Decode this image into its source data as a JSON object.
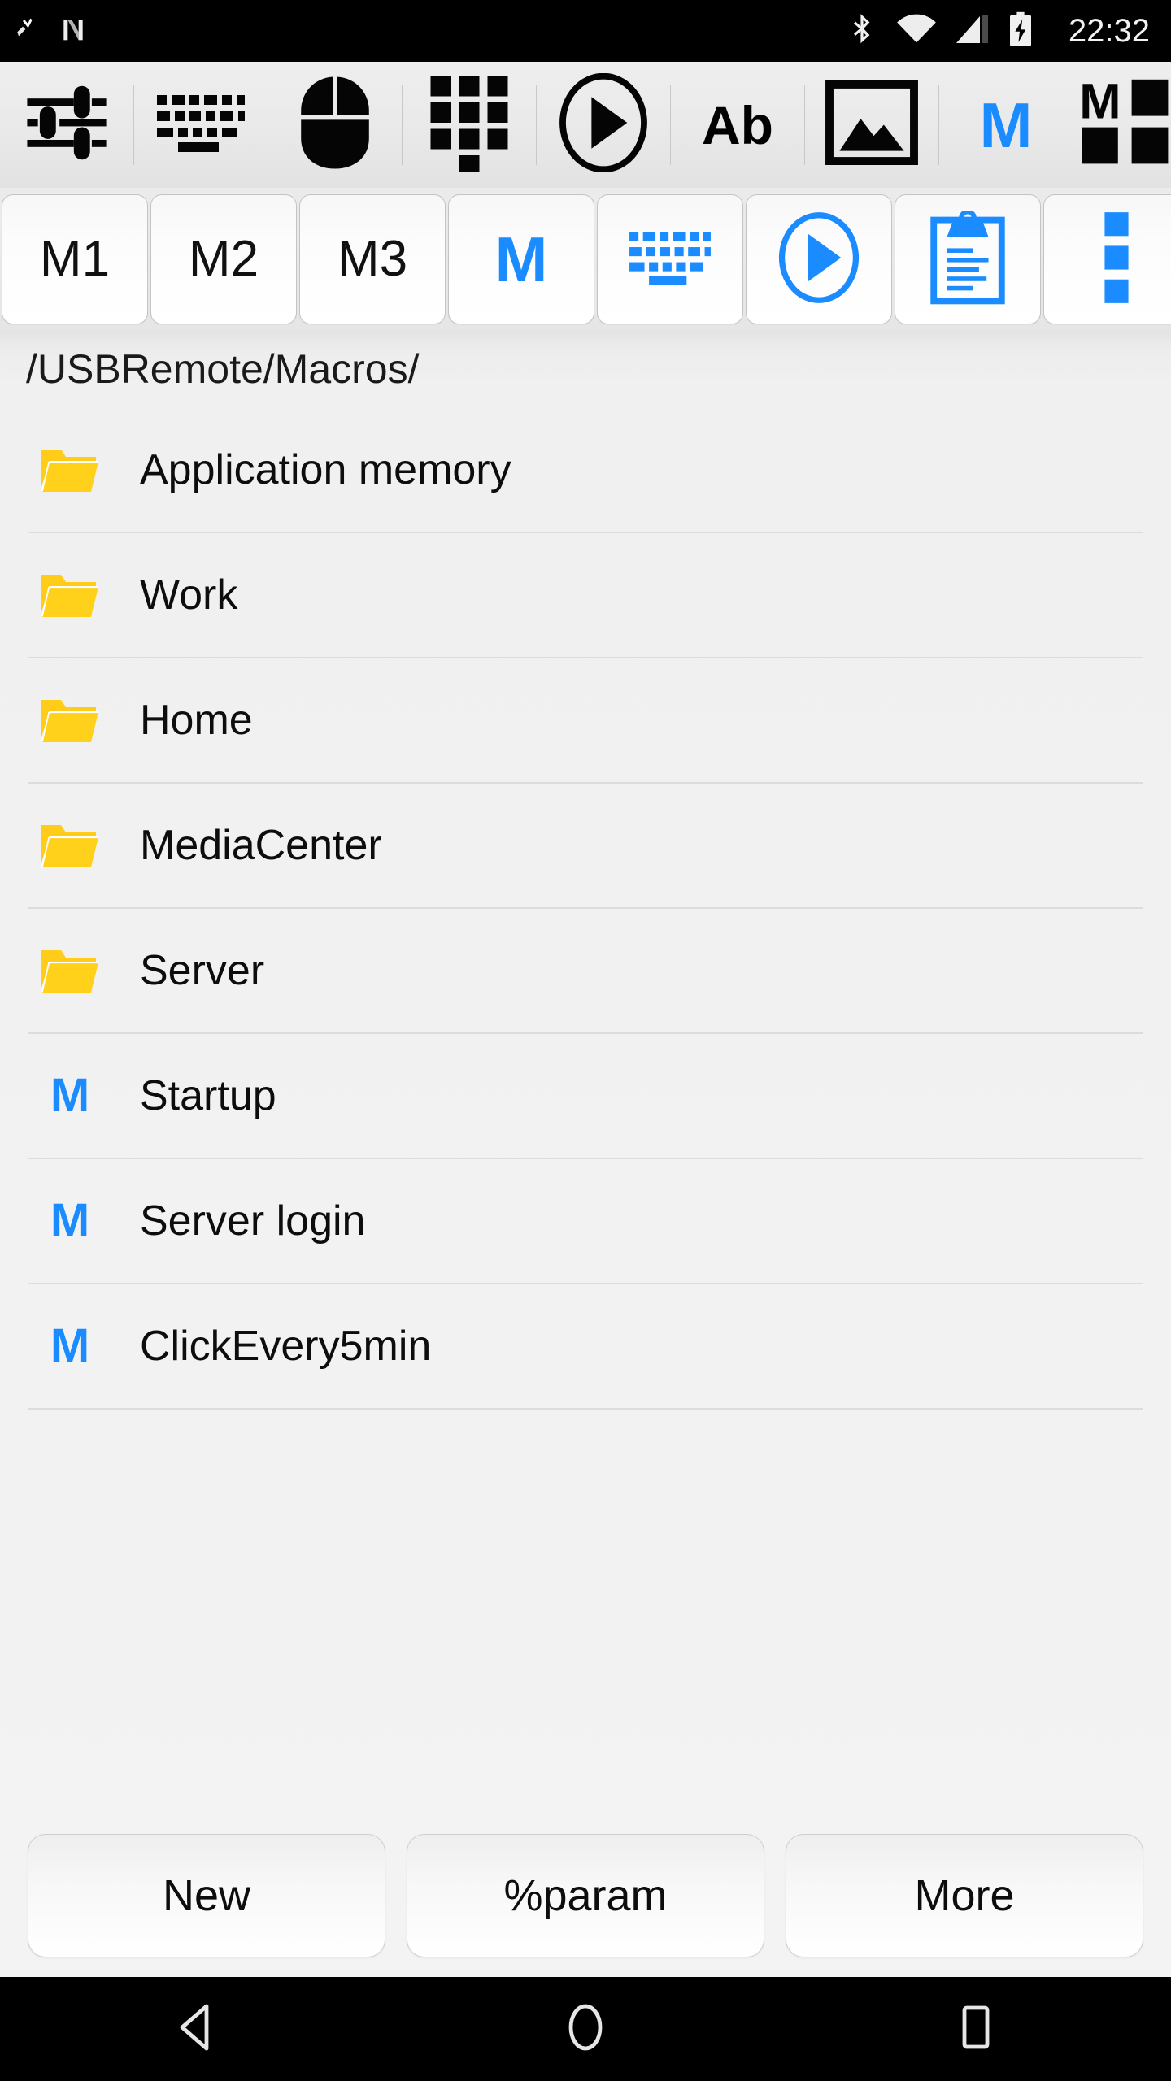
{
  "status_bar": {
    "time": "22:32",
    "left_icons": [
      "app-notification-icon",
      "n-logo-icon"
    ],
    "right_icons": [
      "bluetooth-icon",
      "wifi-icon",
      "cellular-signal-icon",
      "battery-charging-icon"
    ]
  },
  "toolbar": {
    "items": [
      {
        "name": "settings-sliders-icon",
        "label": ""
      },
      {
        "name": "keyboard-icon",
        "label": ""
      },
      {
        "name": "mouse-icon",
        "label": ""
      },
      {
        "name": "numpad-icon",
        "label": ""
      },
      {
        "name": "play-icon",
        "label": ""
      },
      {
        "name": "text-ab-icon",
        "label": "Ab"
      },
      {
        "name": "image-icon",
        "label": ""
      },
      {
        "name": "macro-m-icon",
        "label": "M"
      },
      {
        "name": "macro-grid-icon",
        "label": "M"
      }
    ]
  },
  "tabs": [
    {
      "name": "tab-m1",
      "label": "M1",
      "type": "text"
    },
    {
      "name": "tab-m2",
      "label": "M2",
      "type": "text"
    },
    {
      "name": "tab-m3",
      "label": "M3",
      "type": "text"
    },
    {
      "name": "tab-macro",
      "label": "M",
      "type": "blue-m"
    },
    {
      "name": "tab-keyboard",
      "label": "",
      "type": "keyboard-icon"
    },
    {
      "name": "tab-play",
      "label": "",
      "type": "play-icon"
    },
    {
      "name": "tab-clipboard",
      "label": "",
      "type": "clipboard-icon"
    },
    {
      "name": "tab-overflow",
      "label": "",
      "type": "overflow-icon"
    }
  ],
  "path": "/USBRemote/Macros/",
  "files": [
    {
      "name": "Application memory",
      "type": "folder"
    },
    {
      "name": "Work",
      "type": "folder"
    },
    {
      "name": "Home",
      "type": "folder"
    },
    {
      "name": "MediaCenter",
      "type": "folder"
    },
    {
      "name": "Server",
      "type": "folder"
    },
    {
      "name": "Startup",
      "type": "macro"
    },
    {
      "name": "Server login",
      "type": "macro"
    },
    {
      "name": "ClickEvery5min",
      "type": "macro"
    }
  ],
  "bottom_buttons": [
    {
      "name": "new-button",
      "label": "New"
    },
    {
      "name": "param-button",
      "label": "%param"
    },
    {
      "name": "more-button",
      "label": "More"
    }
  ],
  "nav_bar": {
    "back": "back-icon",
    "home": "home-icon",
    "recents": "recents-icon"
  },
  "colors": {
    "accent_blue": "#1a8cff",
    "folder_yellow": "#FFCC1A",
    "status_bar_bg": "#000000",
    "content_bg": "#f2f2f2",
    "divider": "#dcdcdc"
  }
}
